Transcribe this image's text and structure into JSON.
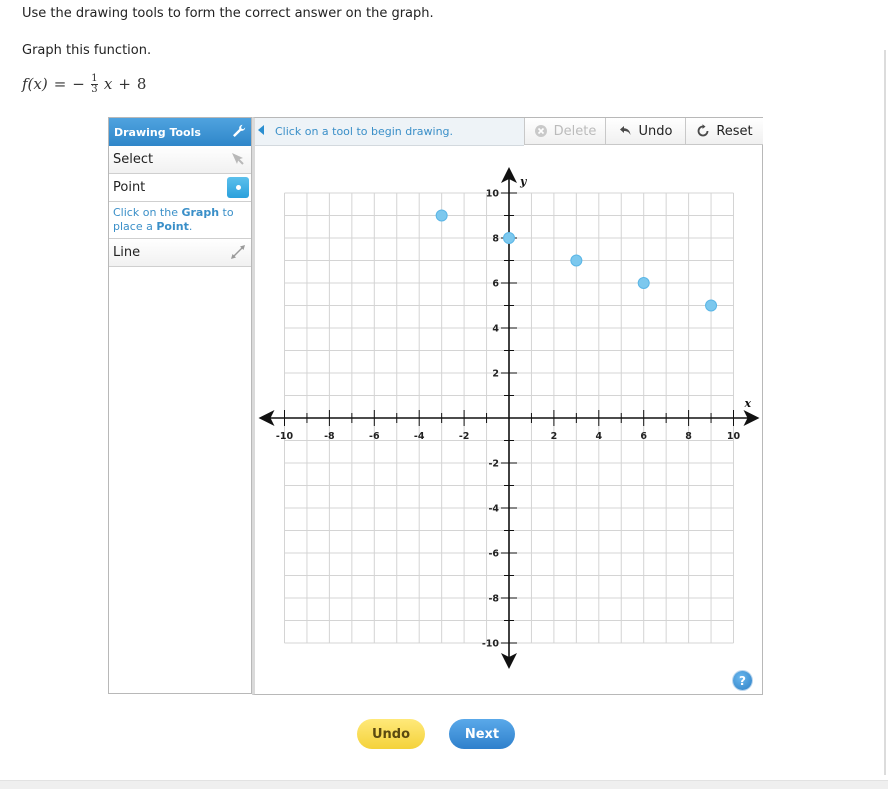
{
  "instructions": "Use the drawing tools to form the correct answer on the graph.",
  "prompt": "Graph this function.",
  "function": {
    "lhs": "f(x)",
    "equals": "=",
    "sign": "−",
    "numerator": "1",
    "denominator": "3",
    "variable": "x",
    "plus": "+",
    "constant": "8"
  },
  "toolbox": {
    "title": "Drawing Tools",
    "title_icon": "wrench-icon",
    "tools": [
      {
        "label": "Select",
        "icon": "pointer-icon"
      },
      {
        "label": "Point",
        "icon": "point-icon",
        "active": true
      },
      {
        "label": "Line",
        "icon": "line-tool-icon"
      }
    ],
    "hint": {
      "pre": "Click on the ",
      "graph": "Graph",
      "mid": " to place a ",
      "point": "Point",
      "post": "."
    }
  },
  "graph_toolbar": {
    "message": "Click on a tool to begin drawing.",
    "delete_label": "Delete",
    "undo_label": "Undo",
    "reset_label": "Reset"
  },
  "help_label": "?",
  "footer": {
    "undo_label": "Undo",
    "next_label": "Next"
  },
  "colors": {
    "accent": "#2f86c9",
    "point": "#7cc8ee",
    "grid": "#d4d4d4",
    "undo_button": "#f4d23a",
    "next_button": "#2f80cc"
  },
  "chart_data": {
    "type": "scatter",
    "xlabel": "x",
    "ylabel": "y",
    "xlim": [
      -10,
      10
    ],
    "ylim": [
      -10,
      10
    ],
    "x_tick_labels": [
      "-10",
      "-8",
      "-6",
      "-4",
      "-2",
      "2",
      "4",
      "6",
      "8",
      "10"
    ],
    "y_tick_labels": [
      "10",
      "8",
      "6",
      "4",
      "2",
      "-2",
      "-4",
      "-6",
      "-8",
      "-10"
    ],
    "grid": true,
    "points": [
      {
        "x": -3,
        "y": 9
      },
      {
        "x": 0,
        "y": 8
      },
      {
        "x": 3,
        "y": 7
      },
      {
        "x": 6,
        "y": 6
      },
      {
        "x": 9,
        "y": 5
      }
    ]
  }
}
